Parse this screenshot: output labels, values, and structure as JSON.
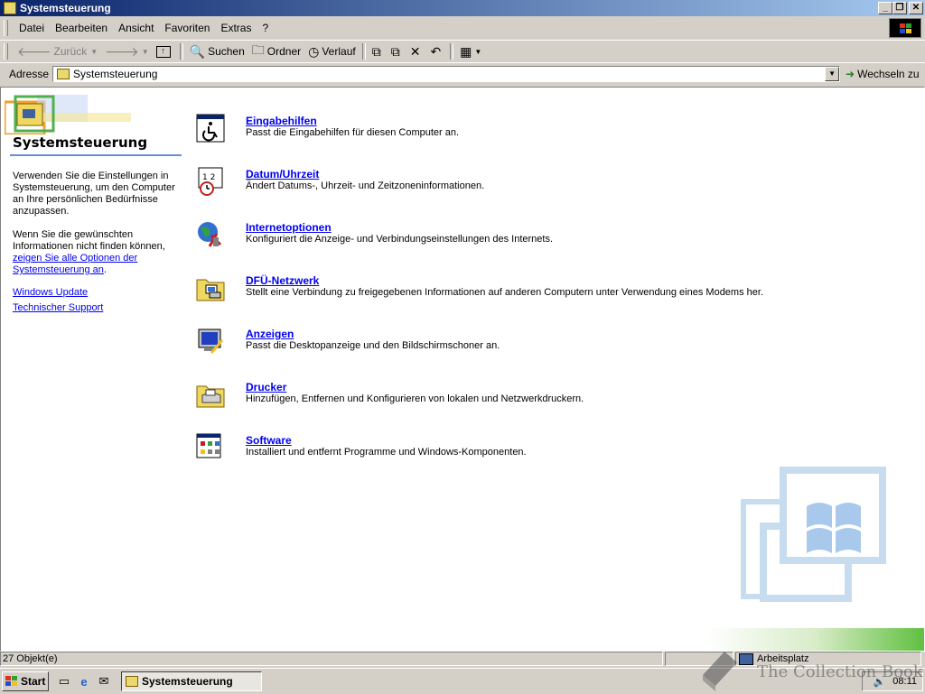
{
  "window": {
    "title": "Systemsteuerung"
  },
  "menubar": [
    "Datei",
    "Bearbeiten",
    "Ansicht",
    "Favoriten",
    "Extras",
    "?"
  ],
  "toolbar": {
    "back": "Zurück",
    "search": "Suchen",
    "folders": "Ordner",
    "history": "Verlauf"
  },
  "address": {
    "label": "Adresse",
    "value": "Systemsteuerung",
    "go": "Wechseln zu"
  },
  "left_pane": {
    "title": "Systemsteuerung",
    "desc1": "Verwenden Sie die Einstellungen in Systemsteuerung, um den Computer an Ihre persönlichen Bedürfnisse anzupassen.",
    "desc2": "Wenn Sie die gewünschten Informationen nicht finden können,",
    "show_all_link": "zeigen Sie alle Optionen der Systemsteuerung an",
    "period": ".",
    "windows_update": "Windows Update",
    "support": "Technischer Support"
  },
  "items": [
    {
      "name": "Eingabehilfen",
      "desc": "Passt die Eingabehilfen für diesen Computer an.",
      "icon": "accessibility-icon"
    },
    {
      "name": "Datum/Uhrzeit",
      "desc": "Ändert Datums-, Uhrzeit- und Zeitzoneninformationen.",
      "icon": "date-time-icon"
    },
    {
      "name": "Internetoptionen",
      "desc": "Konfiguriert die Anzeige- und Verbindungseinstellungen des Internets.",
      "icon": "internet-options-icon"
    },
    {
      "name": "DFÜ-Netzwerk",
      "desc": "Stellt eine Verbindung zu freigegebenen Informationen auf anderen Computern unter Verwendung eines Modems her.",
      "icon": "dialup-network-icon"
    },
    {
      "name": "Anzeigen",
      "desc": "Passt die Desktopanzeige und den Bildschirmschoner an.",
      "icon": "display-icon"
    },
    {
      "name": "Drucker",
      "desc": "Hinzufügen, Entfernen und Konfigurieren von lokalen und Netzwerkdruckern.",
      "icon": "printers-icon"
    },
    {
      "name": "Software",
      "desc": "Installiert und entfernt Programme und Windows-Komponenten.",
      "icon": "software-icon"
    }
  ],
  "statusbar": {
    "count": "27 Objekt(e)",
    "zone": "Arbeitsplatz"
  },
  "taskbar": {
    "start": "Start",
    "task": "Systemsteuerung",
    "clock": "08:11"
  },
  "watermark": "The Collection Book"
}
